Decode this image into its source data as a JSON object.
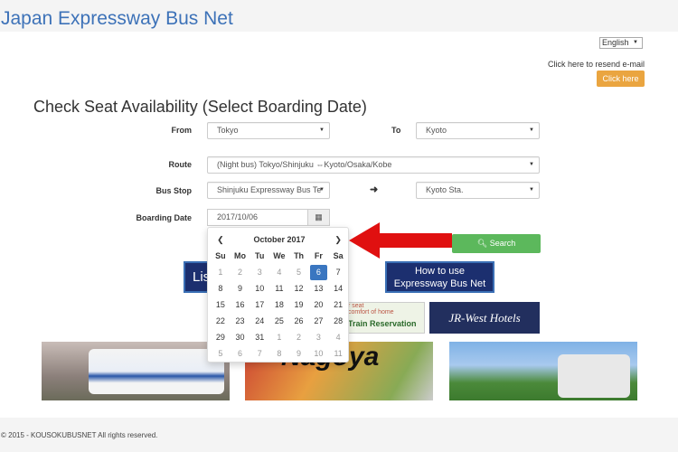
{
  "header": {
    "title": "Japan Expressway Bus Net"
  },
  "language": {
    "selected": "English"
  },
  "resend": {
    "text": "Click here to resend e-mail",
    "button": "Click here"
  },
  "heading": "Check Seat Availability (Select Boarding Date)",
  "form": {
    "from_label": "From",
    "from_value": "Tokyo",
    "to_label": "To",
    "to_value": "Kyoto",
    "route_label": "Route",
    "route_value": "(Night bus) Tokyo/Shinjuku ⇔Kyoto/Osaka/Kobe",
    "busstop_label": "Bus Stop",
    "busstop_from": "Shinjuku Expressway Bus Te",
    "busstop_to": "Kyoto Sta.",
    "date_label": "Boarding Date",
    "date_value": "2017/10/06",
    "search_label": "Search"
  },
  "calendar": {
    "month": "October 2017",
    "weekdays": [
      "Su",
      "Mo",
      "Tu",
      "We",
      "Th",
      "Fr",
      "Sa"
    ],
    "selected_day": "6",
    "weeks": [
      [
        "1",
        "2",
        "3",
        "4",
        "5",
        "6",
        "7"
      ],
      [
        "8",
        "9",
        "10",
        "11",
        "12",
        "13",
        "14"
      ],
      [
        "15",
        "16",
        "17",
        "18",
        "19",
        "20",
        "21"
      ],
      [
        "22",
        "23",
        "24",
        "25",
        "26",
        "27",
        "28"
      ],
      [
        "29",
        "30",
        "31",
        "1",
        "2",
        "3",
        "4"
      ],
      [
        "5",
        "6",
        "7",
        "8",
        "9",
        "10",
        "11"
      ]
    ]
  },
  "banners": {
    "list": "Lis",
    "howto_1": "How to use",
    "howto_2": "Expressway Bus Net",
    "train_1": "r seat",
    "train_2": "comfort of home",
    "train_3": "Train Reservation",
    "jrwest": "JR-West Hotels",
    "nagoya": "Nagoya"
  },
  "footer": {
    "copyright": "© 2015 - KOUSOKUBUSNET All rights reserved."
  },
  "colors": {
    "title": "#3d72b8",
    "orange_button": "#eaa540",
    "search_button": "#5cb85c",
    "selected_date": "#3a76c0",
    "arrow": "#e01010"
  }
}
